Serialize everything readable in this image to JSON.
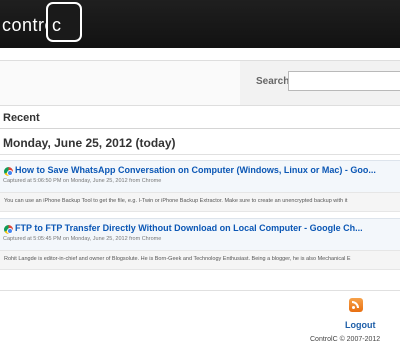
{
  "header": {
    "logo_text": "contro",
    "logo_box_letter": "c"
  },
  "search": {
    "label": "Search:",
    "value": "",
    "placeholder": ""
  },
  "section": {
    "title": "Recent",
    "date_heading": "Monday, June 25, 2012 (today)"
  },
  "clips": [
    {
      "title": "How to Save WhatsApp Conversation on Computer (Windows, Linux or Mac) - Goo...",
      "meta": "Captured at 5:06:50 PM on Monday, June 25, 2012 from Chrome",
      "snippet": "You can use an iPhone Backup Tool to get the file, e.g. I-Twin or iPhone Backup Extractor. Make sure to create an unencrypted backup with it",
      "source_icon": "chrome-icon"
    },
    {
      "title": "FTP to FTP Transfer Directly Without Download on Local Computer - Google Ch...",
      "meta": "Captured at 5:05:45 PM on Monday, June 25, 2012 from Chrome",
      "snippet": "Rohit Langde is editor-in-chief and owner of Blogsolute. He is Born-Geek and Technology Enthusiast. Being a blogger, he is also Mechanical E",
      "source_icon": "chrome-icon"
    }
  ],
  "footer": {
    "rss_icon": "rss-icon",
    "logout_label": "Logout",
    "copyright": "ControlC © 2007-2012"
  },
  "colors": {
    "header_bg": "#161616",
    "link": "#0b57b5",
    "rss": "#e86f11"
  }
}
